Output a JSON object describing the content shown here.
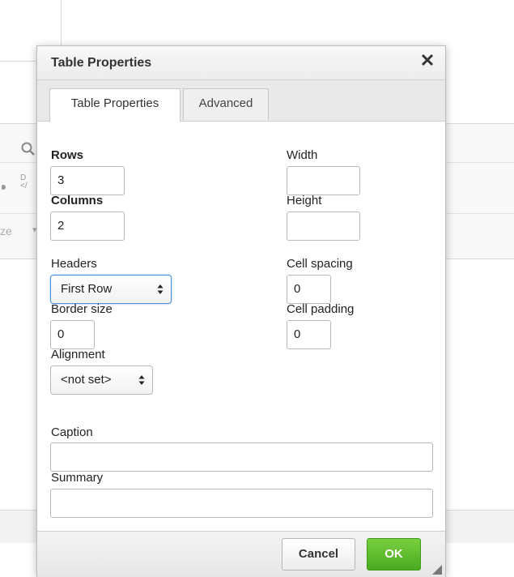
{
  "background": {
    "toolbar_fragment_text": "ze",
    "search_icon": "search-icon",
    "code_icon_label": "D"
  },
  "dialog": {
    "title": "Table Properties",
    "close_icon": "close-icon",
    "tabs": [
      {
        "label": "Table Properties",
        "active": true
      },
      {
        "label": "Advanced",
        "active": false
      }
    ],
    "fields": {
      "rows": {
        "label": "Rows",
        "value": "3"
      },
      "columns": {
        "label": "Columns",
        "value": "2"
      },
      "width": {
        "label": "Width",
        "value": ""
      },
      "height": {
        "label": "Height",
        "value": ""
      },
      "headers": {
        "label": "Headers",
        "value": "First Row"
      },
      "cell_spacing": {
        "label": "Cell spacing",
        "value": "0"
      },
      "border_size": {
        "label": "Border size",
        "value": "0"
      },
      "cell_padding": {
        "label": "Cell padding",
        "value": "0"
      },
      "alignment": {
        "label": "Alignment",
        "value": "<not set>"
      },
      "caption": {
        "label": "Caption",
        "value": ""
      },
      "summary": {
        "label": "Summary",
        "value": ""
      }
    },
    "buttons": {
      "cancel": "Cancel",
      "ok": "OK"
    },
    "colors": {
      "ok_green": "#5cb82f",
      "focus_blue": "#4a90d9"
    }
  }
}
